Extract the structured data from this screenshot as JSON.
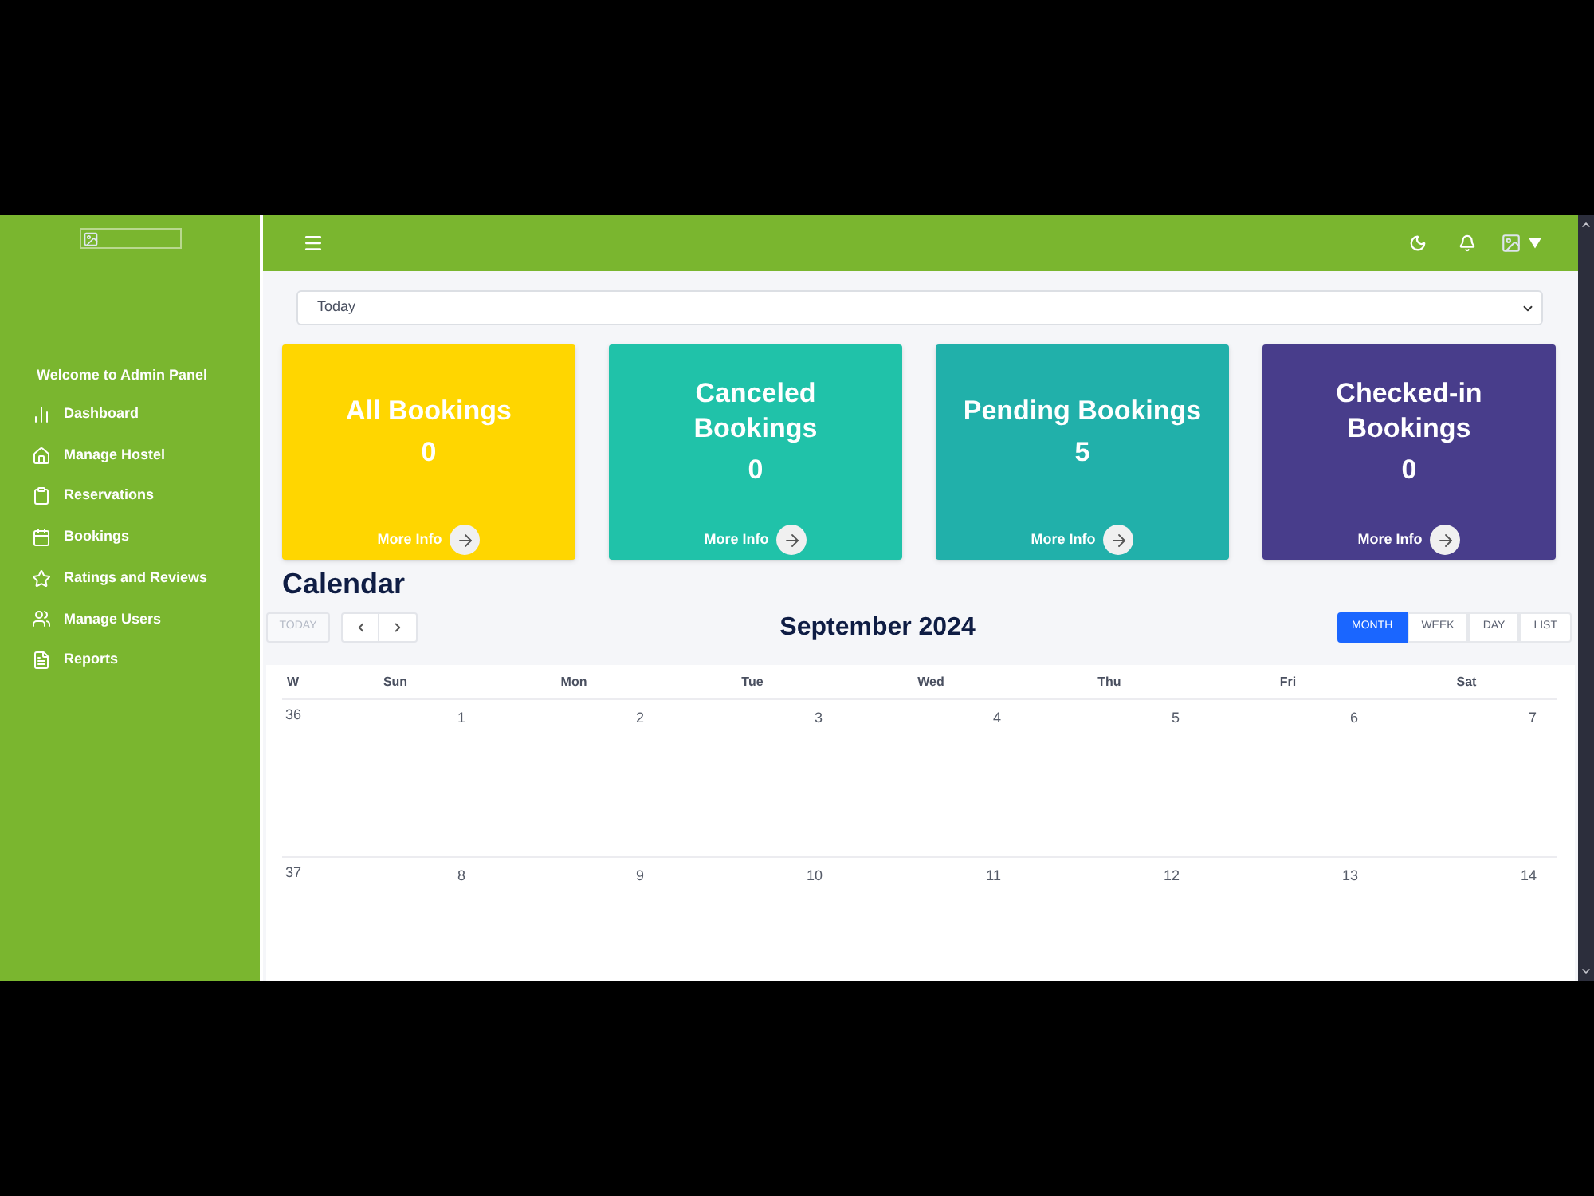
{
  "sidebar": {
    "title": "Welcome to Admin Panel",
    "items": [
      {
        "label": "Dashboard",
        "selected": false
      },
      {
        "label": "Manage Hostel",
        "selected": false
      },
      {
        "label": "Reservations",
        "selected": false
      },
      {
        "label": "Bookings",
        "selected": false
      },
      {
        "label": "Ratings and Reviews",
        "selected": false
      },
      {
        "label": "Manage Users",
        "selected": false
      },
      {
        "label": "Reports",
        "selected": false
      }
    ]
  },
  "filter": {
    "value": "Today"
  },
  "cards": [
    {
      "title": "All Bookings",
      "count": "0",
      "link": "More Info",
      "color": "#ffd600"
    },
    {
      "title": "Canceled Bookings",
      "count": "0",
      "link": "More Info",
      "color": "#20c2a9"
    },
    {
      "title": "Pending Bookings",
      "count": "5",
      "link": "More Info",
      "color": "#21b0aa"
    },
    {
      "title": "Checked-in Bookings",
      "count": "0",
      "link": "More Info",
      "color": "#483d8b"
    }
  ],
  "calendar": {
    "title": "Calendar",
    "today_button": {
      "label": "TODAY",
      "disabled": true
    },
    "heading": "September 2024",
    "views": [
      {
        "label": "MONTH",
        "selected": true
      },
      {
        "label": "WEEK",
        "selected": false
      },
      {
        "label": "DAY",
        "selected": false
      },
      {
        "label": "LIST",
        "selected": false
      }
    ],
    "columns": [
      "W",
      "Sun",
      "Mon",
      "Tue",
      "Wed",
      "Thu",
      "Fri",
      "Sat"
    ],
    "weeks": [
      {
        "number": "36",
        "days": [
          "1",
          "2",
          "3",
          "4",
          "5",
          "6",
          "7"
        ]
      },
      {
        "number": "37",
        "days": [
          "8",
          "9",
          "10",
          "11",
          "12",
          "13",
          "14"
        ]
      }
    ]
  }
}
